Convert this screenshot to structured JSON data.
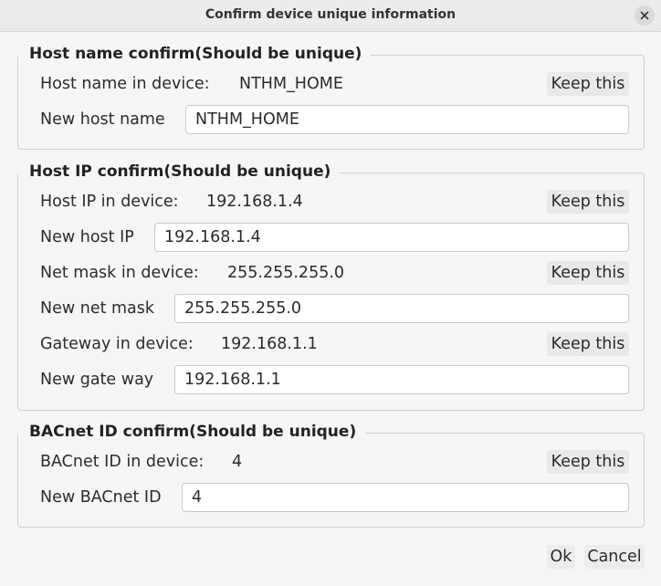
{
  "window": {
    "title": "Confirm device unique information",
    "close_icon": "close-icon"
  },
  "host_name_group": {
    "title": "Host name confirm(Should be unique)",
    "device_label": "Host name in device:",
    "device_value": "NTHM_HOME",
    "keep_label": "Keep this",
    "new_label": "New host name",
    "new_value": "NTHM_HOME"
  },
  "host_ip_group": {
    "title": "Host IP confirm(Should be unique)",
    "ip_device_label": "Host IP in device:",
    "ip_device_value": "192.168.1.4",
    "ip_keep_label": "Keep this",
    "ip_new_label": "New host IP",
    "ip_new_value": "192.168.1.4",
    "mask_device_label": "Net mask in device:",
    "mask_device_value": "255.255.255.0",
    "mask_keep_label": "Keep this",
    "mask_new_label": "New net mask",
    "mask_new_value": "255.255.255.0",
    "gw_device_label": "Gateway in device:",
    "gw_device_value": "192.168.1.1",
    "gw_keep_label": "Keep this",
    "gw_new_label": "New gate way",
    "gw_new_value": "192.168.1.1"
  },
  "bacnet_group": {
    "title": "BACnet ID confirm(Should be unique)",
    "device_label": "BACnet ID in device:",
    "device_value": "4",
    "keep_label": "Keep this",
    "new_label": "New BACnet ID",
    "new_value": "4"
  },
  "buttons": {
    "ok_label": "Ok",
    "cancel_label": "Cancel"
  }
}
